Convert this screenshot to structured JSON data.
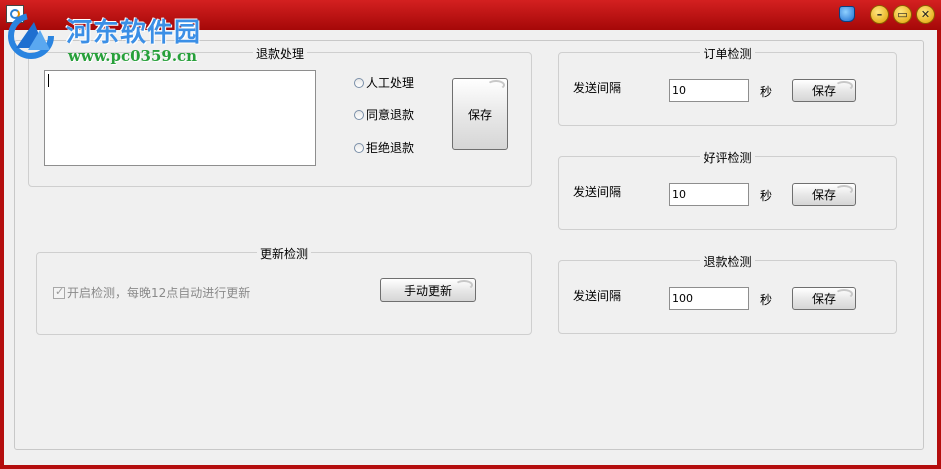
{
  "watermark": {
    "title": "河东软件园",
    "url": "www.pc0359.cn"
  },
  "titlebar": {
    "buttons": [
      "minimize",
      "maximize",
      "close"
    ]
  },
  "refund_processing": {
    "legend": "退款处理",
    "memo_value": "",
    "options": [
      "人工处理",
      "同意退款",
      "拒绝退款"
    ],
    "save_label": "保存"
  },
  "update_check": {
    "legend": "更新检测",
    "auto_check_label": "开启检测，每晚12点自动进行更新",
    "auto_check_checked": true,
    "manual_update_label": "手动更新"
  },
  "order_check": {
    "legend": "订单检测",
    "interval_label": "发送间隔",
    "interval_value": "10",
    "unit": "秒",
    "save_label": "保存"
  },
  "review_check": {
    "legend": "好评检测",
    "interval_label": "发送间隔",
    "interval_value": "10",
    "unit": "秒",
    "save_label": "保存"
  },
  "refund_check": {
    "legend": "退款检测",
    "interval_label": "发送间隔",
    "interval_value": "100",
    "unit": "秒",
    "save_label": "保存"
  },
  "colors": {
    "frame": "#b40d0d",
    "client": "#f0f0f0",
    "watermark_title": "#3b8fe6",
    "watermark_url": "#27a03a"
  }
}
